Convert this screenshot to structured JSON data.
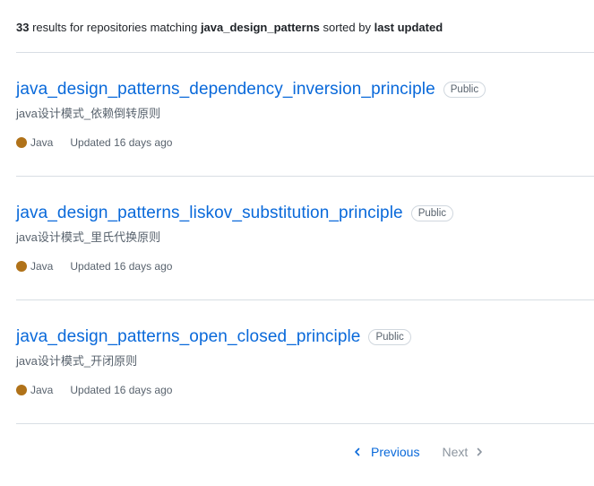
{
  "summary": {
    "count": "33",
    "text_before": " results for repositories matching ",
    "query": "java_design_patterns",
    "text_mid": " sorted by ",
    "sort": "last updated"
  },
  "repos": [
    {
      "name": "java_design_patterns_dependency_inversion_principle",
      "visibility": "Public",
      "description": "java设计模式_依赖倒转原则",
      "language": "Java",
      "language_color": "#b07219",
      "updated": "Updated 16 days ago"
    },
    {
      "name": "java_design_patterns_liskov_substitution_principle",
      "visibility": "Public",
      "description": "java设计模式_里氏代换原则",
      "language": "Java",
      "language_color": "#b07219",
      "updated": "Updated 16 days ago"
    },
    {
      "name": "java_design_patterns_open_closed_principle",
      "visibility": "Public",
      "description": "java设计模式_开闭原则",
      "language": "Java",
      "language_color": "#b07219",
      "updated": "Updated 16 days ago"
    }
  ],
  "pagination": {
    "previous_label": "Previous",
    "next_label": "Next",
    "previous_icon": "chevron-left-icon",
    "next_icon": "chevron-right-icon"
  }
}
